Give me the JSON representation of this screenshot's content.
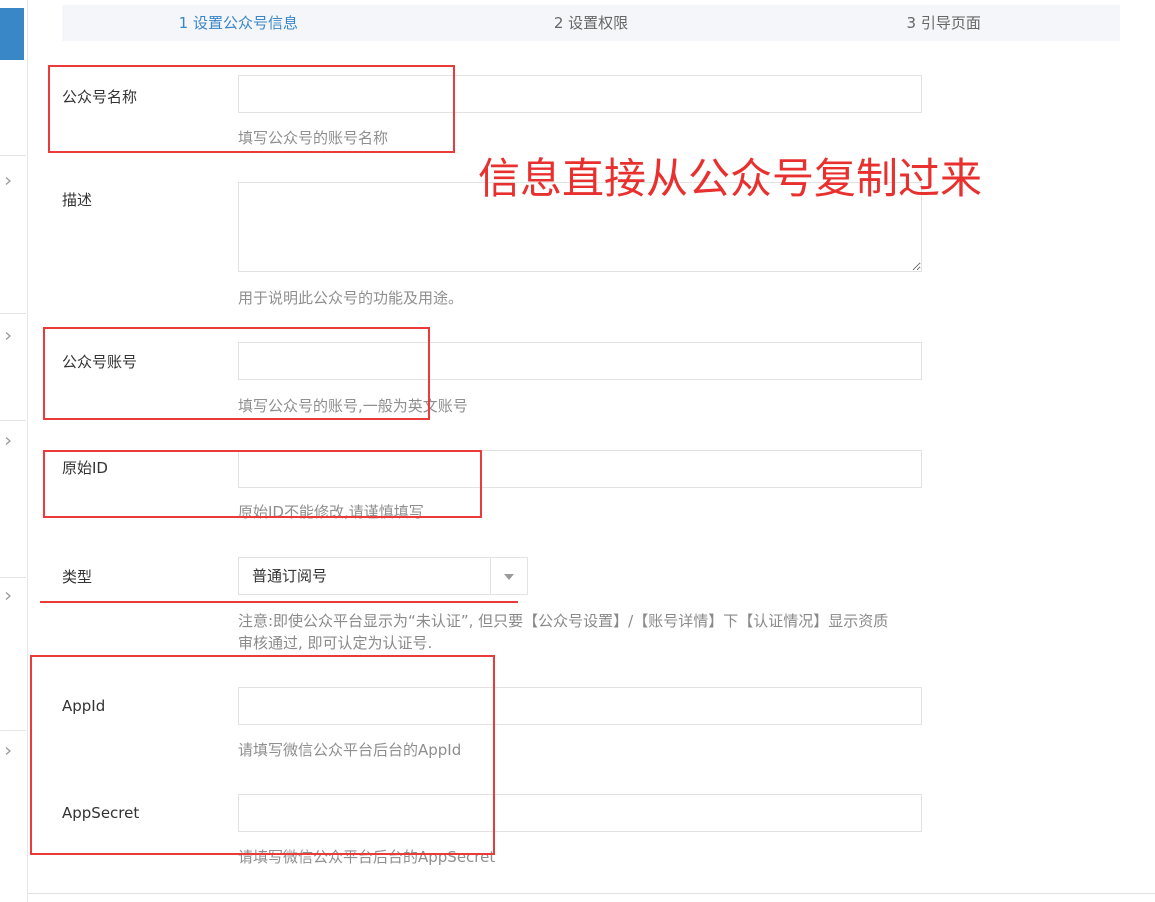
{
  "steps": [
    {
      "label": "1 设置公众号信息",
      "active": true
    },
    {
      "label": "2 设置权限",
      "active": false
    },
    {
      "label": "3 引导页面",
      "active": false
    }
  ],
  "form": {
    "account_name": {
      "label": "公众号名称",
      "value": "",
      "help": "填写公众号的账号名称"
    },
    "description": {
      "label": "描述",
      "value": "",
      "help": "用于说明此公众号的功能及用途。"
    },
    "account": {
      "label": "公众号账号",
      "value": "",
      "help": "填写公众号的账号,一般为英文账号"
    },
    "original_id": {
      "label": "原始ID",
      "value": "",
      "help": "原始ID不能修改,请谨慎填写"
    },
    "type": {
      "label": "类型",
      "selected": "普通订阅号",
      "note_lines": [
        "注意:即使公众平台显示为“未认证”, 但只要【公众号设置】/【账号详情】下【认证情况】显示资质",
        "审核通过, 即可认定为认证号."
      ]
    },
    "app_id": {
      "label": "AppId",
      "value": "",
      "help": "请填写微信公众平台后台的AppId"
    },
    "app_secret": {
      "label": "AppSecret",
      "value": "",
      "help": "请填写微信公众平台后台的AppSecret"
    }
  },
  "annotation": {
    "text": "信息直接从公众号复制过来"
  },
  "icons": {
    "sidebar_item": "chevron-right-icon",
    "select_caret": "caret-down-icon"
  },
  "colors": {
    "accent": "#3a87c8",
    "annotation_red": "#ea3a3a",
    "muted_text": "#8f8f8f"
  }
}
